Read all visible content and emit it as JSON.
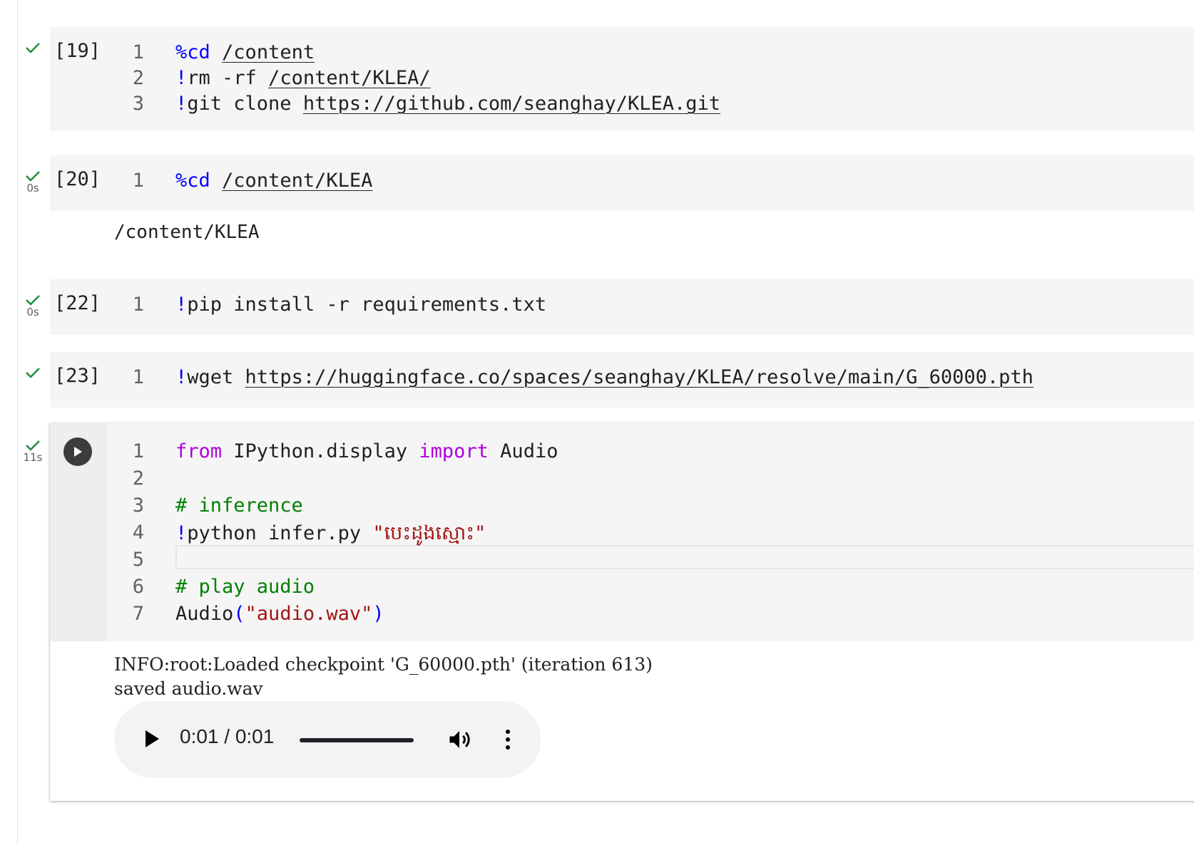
{
  "colors": {
    "check": "#1e8e3e",
    "code_background": "#f5f5f5",
    "keyword_magic": "#0000ff",
    "keyword_import": "#af00db",
    "string": "#a31515",
    "comment": "#008000"
  },
  "cells": {
    "c19": {
      "exec_count": "[19]",
      "lines": [
        {
          "n": "1",
          "a": "%cd",
          "b": " ",
          "c": "/content"
        },
        {
          "n": "2",
          "a": "!",
          "b": "rm -rf ",
          "c": "/content/KLEA/"
        },
        {
          "n": "3",
          "a": "!",
          "b": "git clone ",
          "c": "https://github.com/seanghay/KLEA.git"
        }
      ]
    },
    "c20": {
      "exec_count": "[20]",
      "duration": "0s",
      "lines": [
        {
          "n": "1",
          "a": "%cd",
          "b": " ",
          "c": "/content/KLEA"
        }
      ],
      "output": "/content/KLEA"
    },
    "c22": {
      "exec_count": "[22]",
      "duration": "0s",
      "lines": [
        {
          "n": "1",
          "a": "!",
          "b": "pip install -r requirements.txt"
        }
      ]
    },
    "c23": {
      "exec_count": "[23]",
      "lines": [
        {
          "n": "1",
          "a": "!",
          "b": "wget ",
          "c": "https://huggingface.co/spaces/seanghay/KLEA/resolve/main/G_60000.pth"
        }
      ]
    },
    "c24": {
      "duration": "11s",
      "line_numbers": [
        "1",
        "2",
        "3",
        "4",
        "5",
        "6",
        "7"
      ],
      "l1": {
        "kw_from": "from",
        "module": " IPython.display ",
        "kw_import": "import",
        "name": " Audio"
      },
      "l3": {
        "comment": "# inference"
      },
      "l4": {
        "bang": "!",
        "cmd": "python infer.py ",
        "str": "\"បេះដូងស្មោះ\""
      },
      "l6": {
        "comment": "# play audio"
      },
      "l7": {
        "fn": "Audio",
        "open": "(",
        "str": "\"audio.wav\"",
        "close": ")"
      },
      "output_lines": [
        "INFO:root:Loaded checkpoint 'G_60000.pth' (iteration 613)",
        "saved audio.wav"
      ],
      "audio": {
        "time": "0:01 / 0:01",
        "progress": 1.0
      }
    }
  }
}
